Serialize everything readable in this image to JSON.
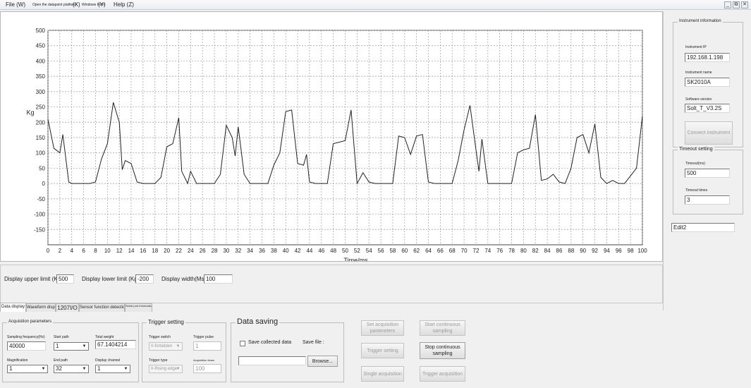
{
  "menu": {
    "file": "File (W)",
    "open_platform": "Open the datapoint platform",
    "open_platform_key": "(X)",
    "windows_form": "Windows Form",
    "windows_form_key": "(Y)",
    "help": "Help (Z)"
  },
  "window_controls": {
    "minimize": "_",
    "restore": "⧉",
    "close": "✕"
  },
  "chart_data": {
    "type": "line",
    "xlabel": "Time/ms",
    "ylabel": "Kg",
    "xlim": [
      0,
      100
    ],
    "ylim": [
      -200,
      500
    ],
    "y_ticks": [
      500,
      450,
      400,
      350,
      300,
      250,
      200,
      150,
      100,
      50,
      0,
      -50,
      -100,
      -150
    ],
    "x_ticks": [
      0,
      2,
      4,
      6,
      8,
      10,
      12,
      14,
      16,
      18,
      20,
      22,
      24,
      26,
      28,
      30,
      32,
      34,
      36,
      38,
      40,
      42,
      44,
      46,
      48,
      50,
      52,
      54,
      56,
      58,
      60,
      62,
      64,
      66,
      68,
      70,
      72,
      74,
      76,
      78,
      80,
      82,
      84,
      86,
      88,
      90,
      92,
      94,
      96,
      98,
      100
    ],
    "grid": true,
    "line_color": "#222222",
    "series": [
      {
        "name": "",
        "points": [
          [
            0,
            210
          ],
          [
            1,
            115
          ],
          [
            2,
            100
          ],
          [
            2.5,
            160
          ],
          [
            3.5,
            5
          ],
          [
            4,
            0
          ],
          [
            7,
            0
          ],
          [
            8,
            5
          ],
          [
            9,
            80
          ],
          [
            10,
            130
          ],
          [
            11,
            265
          ],
          [
            12,
            200
          ],
          [
            12.5,
            45
          ],
          [
            13,
            75
          ],
          [
            14,
            65
          ],
          [
            15,
            5
          ],
          [
            16,
            0
          ],
          [
            18,
            0
          ],
          [
            19,
            20
          ],
          [
            20,
            120
          ],
          [
            21,
            130
          ],
          [
            22,
            215
          ],
          [
            22.5,
            40
          ],
          [
            23.5,
            0
          ],
          [
            24,
            40
          ],
          [
            25,
            0
          ],
          [
            28,
            0
          ],
          [
            29,
            30
          ],
          [
            30,
            190
          ],
          [
            31,
            150
          ],
          [
            31.5,
            90
          ],
          [
            32,
            185
          ],
          [
            33,
            30
          ],
          [
            34,
            0
          ],
          [
            37,
            0
          ],
          [
            38,
            60
          ],
          [
            39,
            100
          ],
          [
            40,
            235
          ],
          [
            41,
            240
          ],
          [
            42,
            65
          ],
          [
            43,
            60
          ],
          [
            43.5,
            95
          ],
          [
            44,
            5
          ],
          [
            45,
            0
          ],
          [
            47,
            0
          ],
          [
            48,
            130
          ],
          [
            49,
            135
          ],
          [
            50,
            140
          ],
          [
            51,
            240
          ],
          [
            52,
            0
          ],
          [
            53,
            35
          ],
          [
            54,
            5
          ],
          [
            55,
            0
          ],
          [
            58,
            0
          ],
          [
            59,
            155
          ],
          [
            60,
            150
          ],
          [
            61,
            95
          ],
          [
            62,
            155
          ],
          [
            63,
            160
          ],
          [
            64,
            5
          ],
          [
            65,
            0
          ],
          [
            68,
            0
          ],
          [
            69,
            75
          ],
          [
            70,
            175
          ],
          [
            71,
            255
          ],
          [
            72,
            110
          ],
          [
            72.5,
            40
          ],
          [
            73,
            145
          ],
          [
            74,
            0
          ],
          [
            75,
            0
          ],
          [
            78,
            0
          ],
          [
            79,
            100
          ],
          [
            80,
            110
          ],
          [
            81,
            115
          ],
          [
            82,
            225
          ],
          [
            83,
            10
          ],
          [
            84,
            15
          ],
          [
            85,
            30
          ],
          [
            86,
            5
          ],
          [
            87,
            0
          ],
          [
            88,
            50
          ],
          [
            89,
            150
          ],
          [
            90,
            160
          ],
          [
            91,
            100
          ],
          [
            92,
            195
          ],
          [
            93,
            20
          ],
          [
            94,
            0
          ],
          [
            95,
            10
          ],
          [
            96,
            0
          ],
          [
            97,
            0
          ],
          [
            98,
            25
          ],
          [
            99,
            50
          ],
          [
            100,
            220
          ]
        ]
      }
    ]
  },
  "display_settings": {
    "upper_label": "Display upper limit (Kg)",
    "upper_value": "500",
    "lower_label": "Display lower limit (Kg)",
    "lower_value": "-200",
    "width_label": "Display width(Ms)",
    "width_value": "100"
  },
  "instrument": {
    "title": "Instrument information",
    "ip_label": "Instrument IP",
    "ip_value": "192.168.1.198",
    "name_label": "Instrument name",
    "name_value": "SK2010A",
    "version_label": "Software version",
    "version_value": "Solt_T_V3.2S",
    "connect_button": "Connect instrument"
  },
  "timeout": {
    "title": "Timeout setting",
    "timeout_label": "Timeout(ms)",
    "timeout_value": "500",
    "times_label": "Timeout times",
    "times_value": "3"
  },
  "edit2": "Edit2",
  "tabs": [
    {
      "label": "Data display"
    },
    {
      "label": "Waveform display"
    },
    {
      "label": "1207I/O"
    },
    {
      "label": "Sensor function detection"
    },
    {
      "label": "Serial port information"
    }
  ],
  "acquisition": {
    "title": "Acquisition parameters",
    "sampling_label": "Sampling frequency(Hz)",
    "sampling_value": "40000",
    "start_path_label": "Start path",
    "start_path_value": "1",
    "total_weight_label": "Total weight",
    "total_weight_value": "67.1404214",
    "magnification_label": "Magnification",
    "magnification_value": "1",
    "end_path_label": "End path",
    "end_path_value": "32",
    "display_channel_label": "Display channel",
    "display_channel_value": "1"
  },
  "trigger": {
    "title": "Trigger setting",
    "switch_label": "Trigger switch",
    "switch_value": "0-forbidden",
    "pulse_label": "Trigger pulse",
    "pulse_value": "1",
    "type_label": "Trigger type",
    "type_value": "0-Rising edge",
    "times_label": "Acquisition times",
    "times_value": "100"
  },
  "data_saving": {
    "title": "Data saving",
    "save_collected_label": "Save collected data",
    "save_file_label": "Save file :",
    "file_value": "",
    "browse_button": "Browse..."
  },
  "buttons": {
    "set_acquisition": "Set acquisition parameters",
    "start_continuous": "Start continuous sampling",
    "trigger_setting": "Trigger setting",
    "stop_continuous": "Stop continuous sampling",
    "single_acquisition": "Single acquisition",
    "trigger_acquisition": "Trigger acquisition"
  }
}
